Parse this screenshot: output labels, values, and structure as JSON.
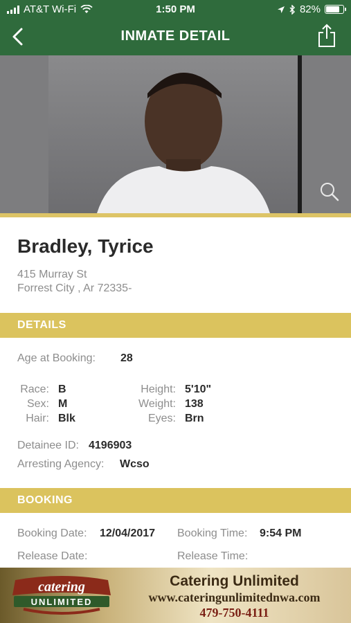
{
  "status": {
    "carrier": "AT&T Wi-Fi",
    "time": "1:50 PM",
    "battery": "82%",
    "battery_level": 0.82
  },
  "nav": {
    "title": "INMATE DETAIL",
    "back_icon": "chevron-left-icon",
    "share_icon": "share-icon"
  },
  "inmate": {
    "name": "Bradley, Tyrice",
    "address_line1": "415 Murray St",
    "address_line2": "Forrest City , Ar 72335-"
  },
  "details": {
    "header": "DETAILS",
    "age_label": "Age at Booking:",
    "age_value": "28",
    "race_label": "Race:",
    "race_value": "B",
    "sex_label": "Sex:",
    "sex_value": "M",
    "hair_label": "Hair:",
    "hair_value": "Blk",
    "height_label": "Height:",
    "height_value": "5'10\"",
    "weight_label": "Weight:",
    "weight_value": "138",
    "eyes_label": "Eyes:",
    "eyes_value": "Brn",
    "detainee_label": "Detainee ID:",
    "detainee_value": "4196903",
    "agency_label": "Arresting Agency:",
    "agency_value": "Wcso"
  },
  "booking": {
    "header": "BOOKING",
    "date_label": "Booking Date:",
    "date_value": "12/04/2017",
    "time_label": "Booking Time:",
    "time_value": "9:54 PM",
    "release_date_label": "Release Date:",
    "release_time_label": "Release Time:"
  },
  "ad": {
    "logo_text_top": "catering",
    "logo_text_bottom": "UNLIMITED",
    "brand": "Catering Unlimited",
    "url": "www.cateringunlimitednwa.com",
    "phone": "479-750-4111"
  },
  "colors": {
    "nav_green": "#2f6b3c",
    "section_gold": "#dbc35e"
  }
}
